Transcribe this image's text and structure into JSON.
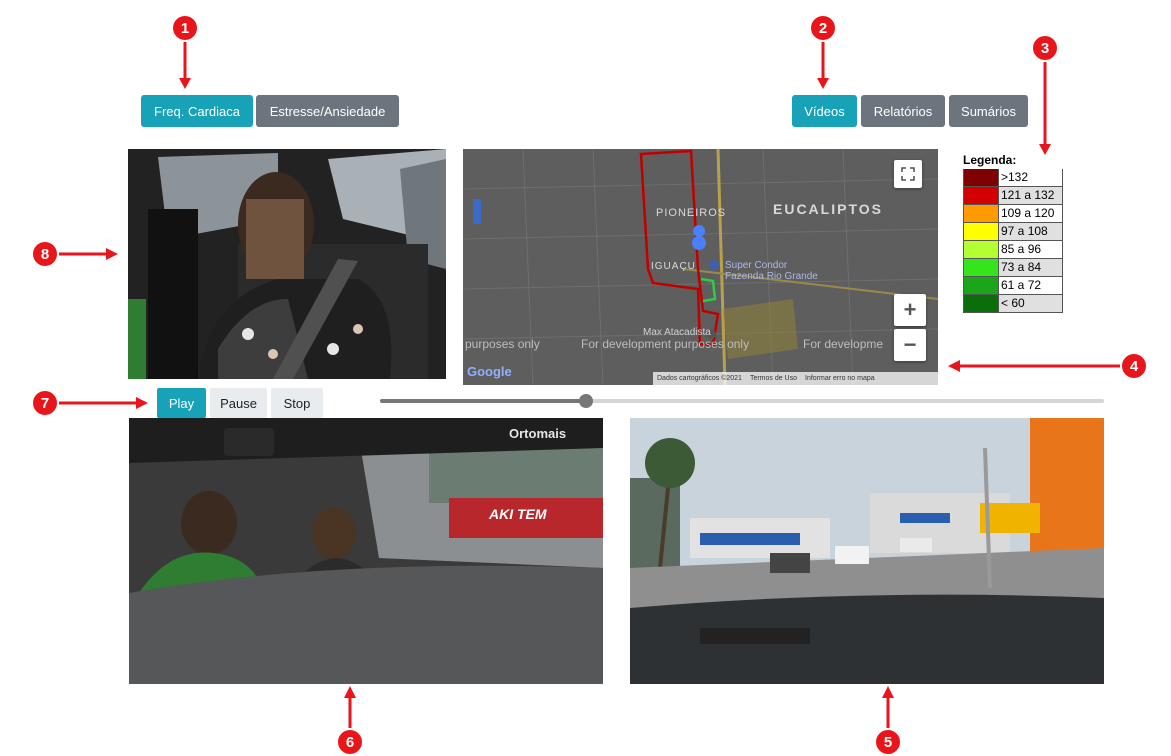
{
  "tabs_left": [
    {
      "label": "Freq. Cardiaca",
      "active": true
    },
    {
      "label": "Estresse/Ansiedade",
      "active": false
    }
  ],
  "tabs_right": [
    {
      "label": "Vídeos",
      "active": true
    },
    {
      "label": "Relatórios",
      "active": false
    },
    {
      "label": "Sumários",
      "active": false
    }
  ],
  "map": {
    "labels": {
      "eucaliptos": "EUCALIPTOS",
      "pioneiros": "PIONEIROS",
      "iguacu": "IGUAÇU",
      "poi1": "Super Condor",
      "poi2": "Fazenda Rio Grande",
      "poi3": "Max Atacadista",
      "dev1": "purposes only",
      "dev2": "For development purposes only",
      "dev3": "For developme",
      "logo": "Google"
    },
    "footer": {
      "attribution": "Dados cartográficos ©2021",
      "terms": "Termos de Uso",
      "report": "Informar erro no mapa"
    },
    "zoom_in": "+",
    "zoom_out": "−"
  },
  "legend": {
    "title": "Legenda:",
    "items": [
      {
        "label": ">132",
        "color": "#7f0000"
      },
      {
        "label": "121 a 132",
        "color": "#d40000"
      },
      {
        "label": "109 a 120",
        "color": "#ff9a00"
      },
      {
        "label": "97 a 108",
        "color": "#ffff00"
      },
      {
        "label": "85 a 96",
        "color": "#b2ff33"
      },
      {
        "label": "73 a 84",
        "color": "#33e51a"
      },
      {
        "label": "61 a 72",
        "color": "#1aa51a"
      },
      {
        "label": "< 60",
        "color": "#0a6e0a"
      }
    ]
  },
  "controls": {
    "play": "Play",
    "pause": "Pause",
    "stop": "Stop"
  },
  "playback": {
    "progress": 0.285
  },
  "video_overlays": {
    "cabin_sign1": "Ortomais",
    "cabin_sign2": "AKI TEM"
  },
  "annotations": [
    "1",
    "2",
    "3",
    "4",
    "5",
    "6",
    "7",
    "8"
  ],
  "colors": {
    "accent": "#17a2b8",
    "secondary": "#6c757d",
    "marker": "#e8161b",
    "route": "#d40000"
  }
}
